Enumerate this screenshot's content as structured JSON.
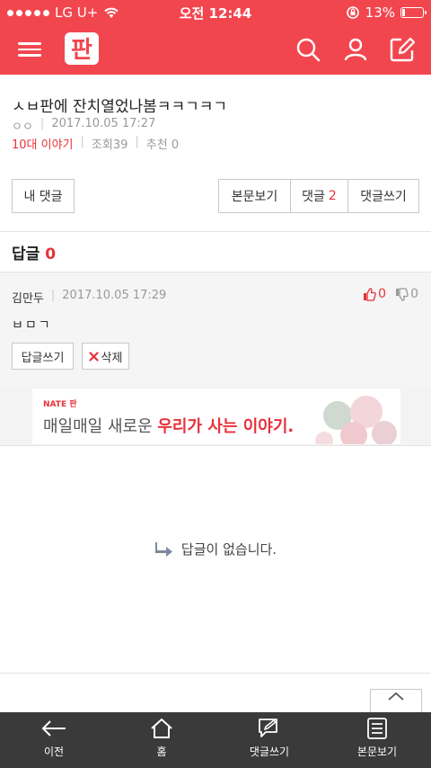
{
  "status_bar": {
    "carrier": "LG U+",
    "time": "오전 12:44",
    "battery": "13%",
    "battery_level": 0.13
  },
  "app_bar": {
    "logo_text": "판",
    "icons": [
      "menu-icon",
      "search-icon",
      "user-icon",
      "edit-icon"
    ],
    "accent": "#f2464f"
  },
  "post": {
    "title": "ㅅㅂ판에 잔치열었나봄ㅋㅋㄱㅋㄱ",
    "author": "ㅇㅇ",
    "date": "2017.10.05 17:27",
    "category": "10대 이야기",
    "views_label": "조회",
    "views": "39",
    "recommend_label": "추천",
    "recommend": "0"
  },
  "tabs": {
    "my_comments": "내 댓글",
    "view_body": "본문보기",
    "comments_label": "댓글",
    "comments_count": "2",
    "write_comment": "댓글쓰기"
  },
  "replies": {
    "label": "답글",
    "count": "0"
  },
  "comment": {
    "author": "김만두",
    "date": "2017.10.05 17:29",
    "up": "0",
    "down": "0",
    "body": "ㅂㅁㄱ",
    "reply_button": "답글쓰기",
    "delete_button": "삭제"
  },
  "ad": {
    "brand": "NATE 판",
    "text_plain": "매일매일 새로운 ",
    "text_bold": "우리가 사는 이야기."
  },
  "empty_message": "답글이 없습니다.",
  "bottom_nav": {
    "back": "이전",
    "home": "홈",
    "write": "댓글쓰기",
    "body": "본문보기"
  }
}
